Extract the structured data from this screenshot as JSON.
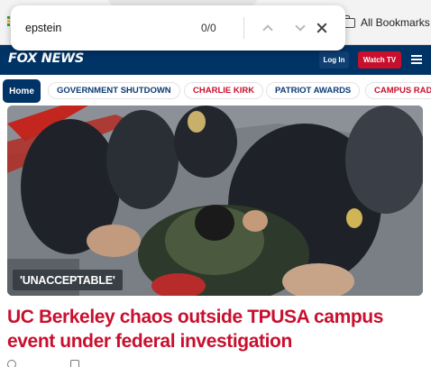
{
  "browser": {
    "bookmarks_label": "All Bookmarks",
    "find_bar": {
      "query": "epstein",
      "count": "0/0"
    }
  },
  "header": {
    "logo_text": "FOX NEWS",
    "login_label": "Log In",
    "watch_label": "Watch TV"
  },
  "nav": {
    "home_label": "Home",
    "items": [
      {
        "label": "GOVERNMENT SHUTDOWN"
      },
      {
        "label": "CHARLIE KIRK"
      },
      {
        "label": "PATRIOT AWARDS"
      },
      {
        "label": "CAMPUS RAD"
      }
    ]
  },
  "story": {
    "badge": "'UNACCEPTABLE'",
    "headline": "UC Berkeley chaos outside TPUSA campus event under federal investigation"
  },
  "colors": {
    "fox_navy": "#003366",
    "fox_red": "#c8102e"
  }
}
